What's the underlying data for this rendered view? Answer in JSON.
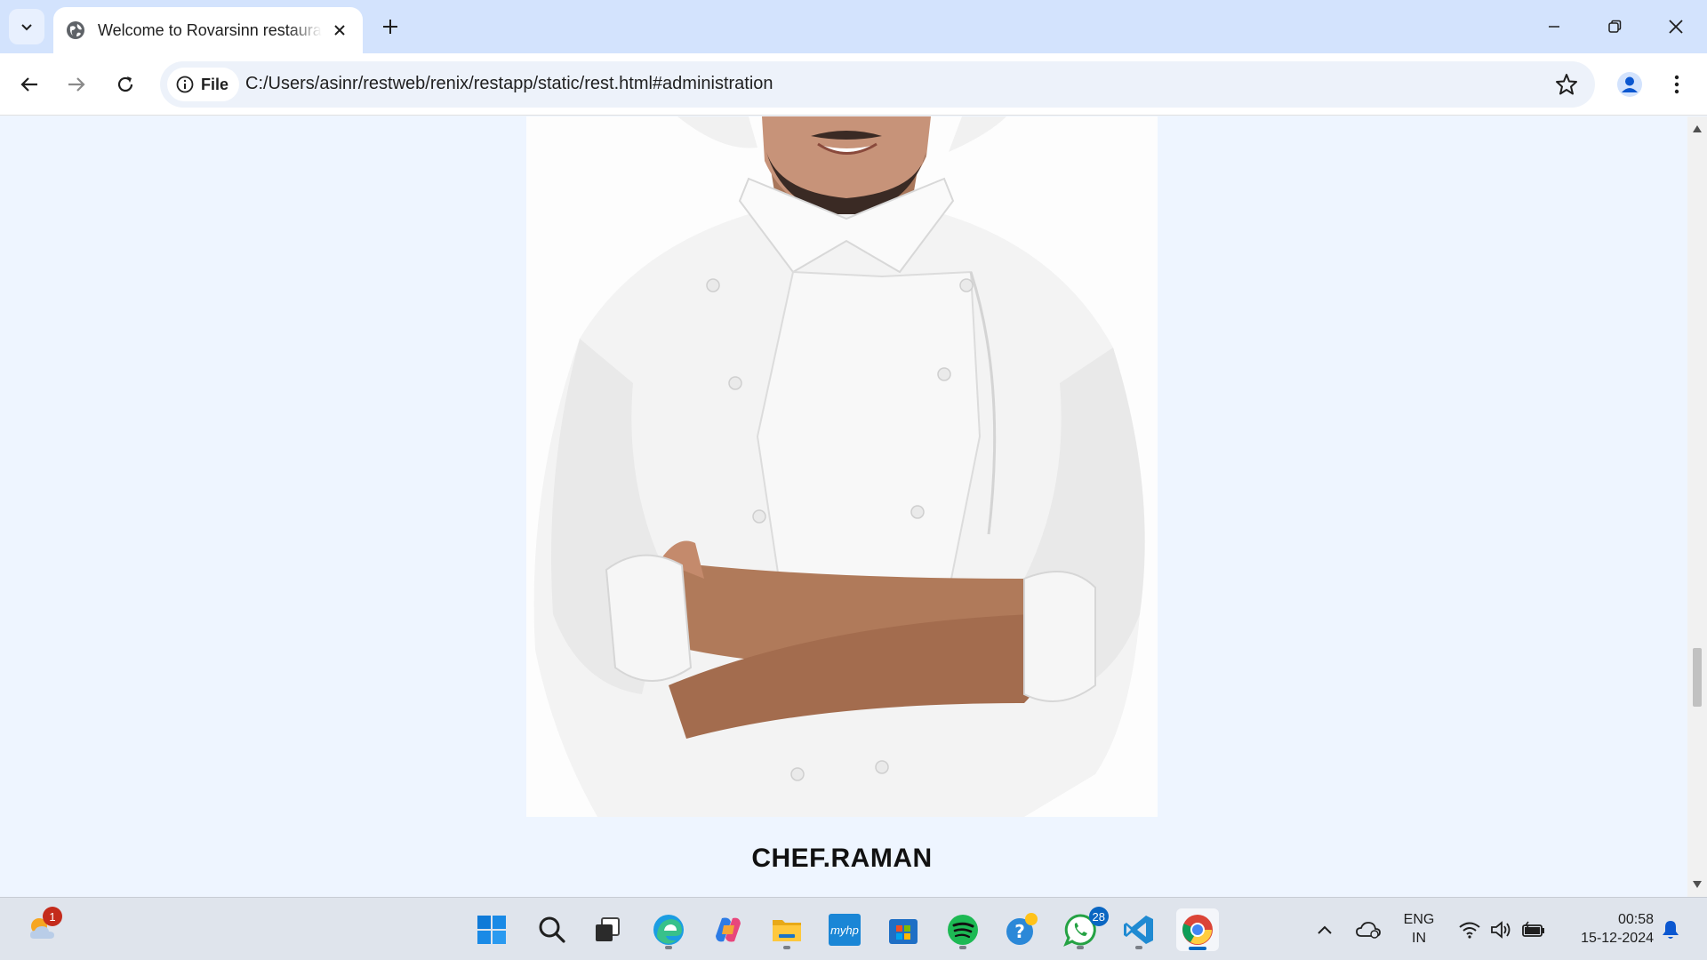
{
  "browser": {
    "tab_title": "Welcome to Rovarsinn restaurant",
    "url_chip_label": "File",
    "url": "C:/Users/asinr/restweb/renix/restapp/static/rest.html#administration"
  },
  "page": {
    "chef_name": "CHEF.RAMAN",
    "chef_image_alt": "Chef in white uniform with arms crossed"
  },
  "taskbar": {
    "weather_badge": "1",
    "whatsapp_badge": "28",
    "language_line1": "ENG",
    "language_line2": "IN",
    "time": "00:58",
    "date": "15-12-2024",
    "myhp_label": "myhp"
  },
  "colors": {
    "tab_strip": "#d3e3fd",
    "page_background": "#eef5ff",
    "chef_jacket": "#f5f5f5",
    "skin": "#b07a5a"
  }
}
